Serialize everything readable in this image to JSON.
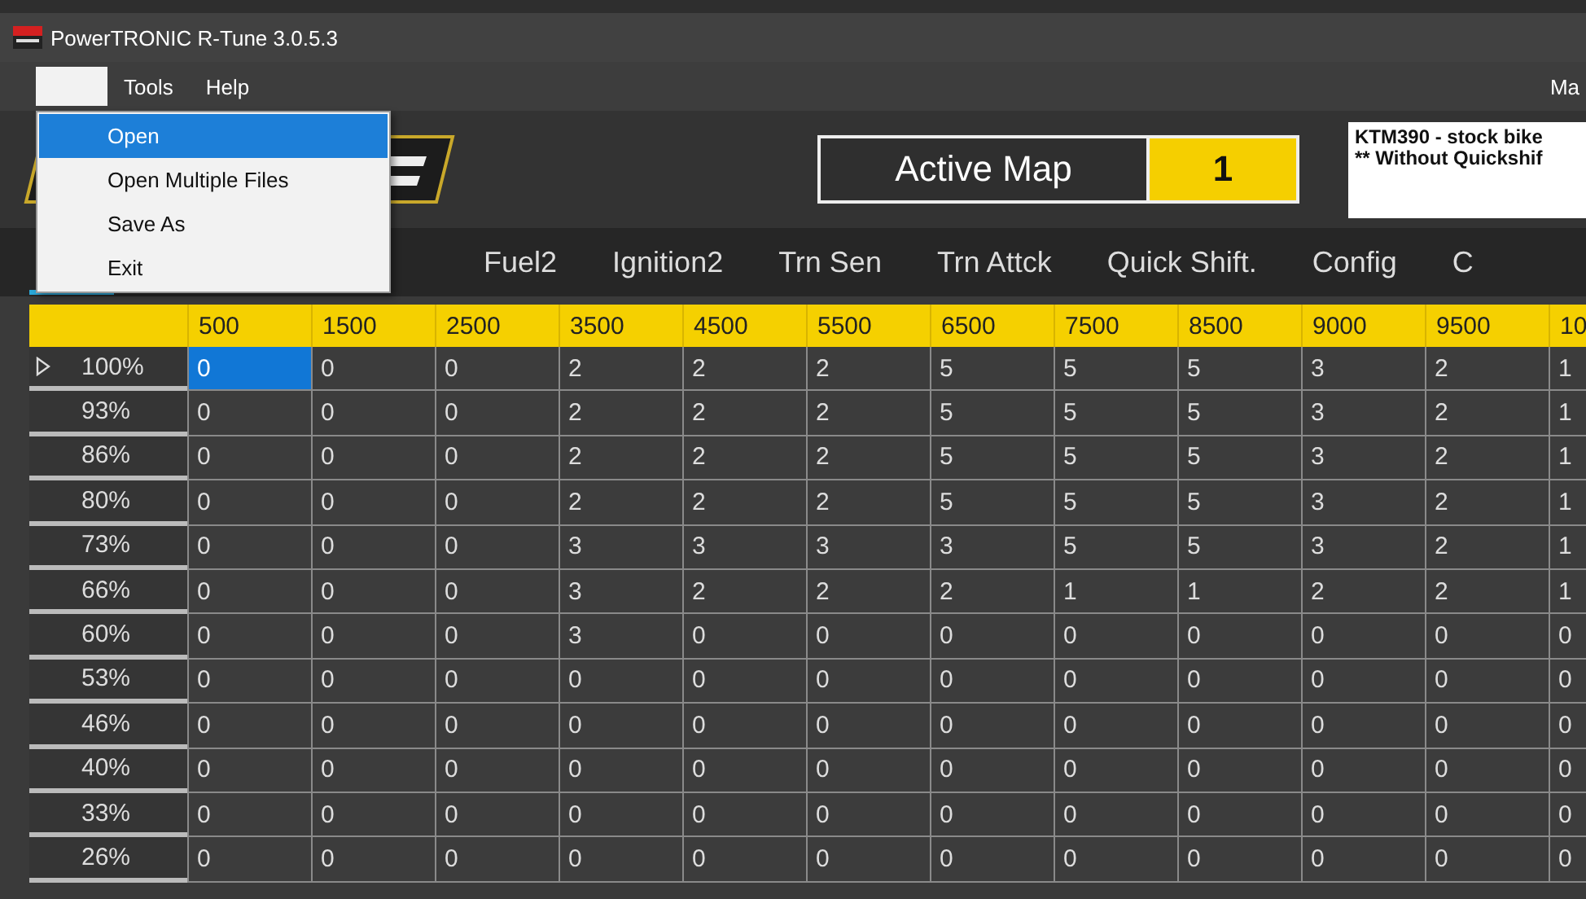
{
  "window": {
    "title": "PowerTRONIC R-Tune 3.0.5.3"
  },
  "menu_bar": {
    "items": [
      {
        "label": "Tools"
      },
      {
        "label": "Help"
      }
    ],
    "right_text": "Ma"
  },
  "file_menu": {
    "items": [
      {
        "label": "Open",
        "selected": true
      },
      {
        "label": "Open Multiple Files",
        "selected": false
      },
      {
        "label": "Save As",
        "selected": false
      },
      {
        "label": "Exit",
        "selected": false
      }
    ]
  },
  "active_map": {
    "label": "Active Map",
    "value": "1"
  },
  "notes": [
    "KTM390 - stock bike",
    "** Without Quickshif"
  ],
  "tabs": [
    "Fuel2",
    "Ignition2",
    "Trn Sen",
    "Trn Attck",
    "Quick Shift.",
    "Config",
    "C"
  ],
  "table": {
    "columns": [
      "500",
      "1500",
      "2500",
      "3500",
      "4500",
      "5500",
      "6500",
      "7500",
      "8500",
      "9000",
      "9500",
      "10"
    ],
    "rows": [
      {
        "label": "100%",
        "selected": true,
        "cells": [
          {
            "v": "0",
            "selected": true
          },
          {
            "v": "0",
            "selected": false
          },
          {
            "v": "0",
            "selected": false
          },
          {
            "v": "2",
            "selected": false
          },
          {
            "v": "2",
            "selected": false
          },
          {
            "v": "2",
            "selected": false
          },
          {
            "v": "5",
            "selected": false
          },
          {
            "v": "5",
            "selected": false
          },
          {
            "v": "5",
            "selected": false
          },
          {
            "v": "3",
            "selected": false
          },
          {
            "v": "2",
            "selected": false
          },
          {
            "v": "1",
            "selected": false
          }
        ]
      },
      {
        "label": "93%",
        "selected": false,
        "cells": [
          {
            "v": "0",
            "selected": false
          },
          {
            "v": "0",
            "selected": false
          },
          {
            "v": "0",
            "selected": false
          },
          {
            "v": "2",
            "selected": false
          },
          {
            "v": "2",
            "selected": false
          },
          {
            "v": "2",
            "selected": false
          },
          {
            "v": "5",
            "selected": false
          },
          {
            "v": "5",
            "selected": false
          },
          {
            "v": "5",
            "selected": false
          },
          {
            "v": "3",
            "selected": false
          },
          {
            "v": "2",
            "selected": false
          },
          {
            "v": "1",
            "selected": false
          }
        ]
      },
      {
        "label": "86%",
        "selected": false,
        "cells": [
          {
            "v": "0",
            "selected": false
          },
          {
            "v": "0",
            "selected": false
          },
          {
            "v": "0",
            "selected": false
          },
          {
            "v": "2",
            "selected": false
          },
          {
            "v": "2",
            "selected": false
          },
          {
            "v": "2",
            "selected": false
          },
          {
            "v": "5",
            "selected": false
          },
          {
            "v": "5",
            "selected": false
          },
          {
            "v": "5",
            "selected": false
          },
          {
            "v": "3",
            "selected": false
          },
          {
            "v": "2",
            "selected": false
          },
          {
            "v": "1",
            "selected": false
          }
        ]
      },
      {
        "label": "80%",
        "selected": false,
        "cells": [
          {
            "v": "0",
            "selected": false
          },
          {
            "v": "0",
            "selected": false
          },
          {
            "v": "0",
            "selected": false
          },
          {
            "v": "2",
            "selected": false
          },
          {
            "v": "2",
            "selected": false
          },
          {
            "v": "2",
            "selected": false
          },
          {
            "v": "5",
            "selected": false
          },
          {
            "v": "5",
            "selected": false
          },
          {
            "v": "5",
            "selected": false
          },
          {
            "v": "3",
            "selected": false
          },
          {
            "v": "2",
            "selected": false
          },
          {
            "v": "1",
            "selected": false
          }
        ]
      },
      {
        "label": "73%",
        "selected": false,
        "cells": [
          {
            "v": "0",
            "selected": false
          },
          {
            "v": "0",
            "selected": false
          },
          {
            "v": "0",
            "selected": false
          },
          {
            "v": "3",
            "selected": false
          },
          {
            "v": "3",
            "selected": false
          },
          {
            "v": "3",
            "selected": false
          },
          {
            "v": "3",
            "selected": false
          },
          {
            "v": "5",
            "selected": false
          },
          {
            "v": "5",
            "selected": false
          },
          {
            "v": "3",
            "selected": false
          },
          {
            "v": "2",
            "selected": false
          },
          {
            "v": "1",
            "selected": false
          }
        ]
      },
      {
        "label": "66%",
        "selected": false,
        "cells": [
          {
            "v": "0",
            "selected": false
          },
          {
            "v": "0",
            "selected": false
          },
          {
            "v": "0",
            "selected": false
          },
          {
            "v": "3",
            "selected": false
          },
          {
            "v": "2",
            "selected": false
          },
          {
            "v": "2",
            "selected": false
          },
          {
            "v": "2",
            "selected": false
          },
          {
            "v": "1",
            "selected": false
          },
          {
            "v": "1",
            "selected": false
          },
          {
            "v": "2",
            "selected": false
          },
          {
            "v": "2",
            "selected": false
          },
          {
            "v": "1",
            "selected": false
          }
        ]
      },
      {
        "label": "60%",
        "selected": false,
        "cells": [
          {
            "v": "0",
            "selected": false
          },
          {
            "v": "0",
            "selected": false
          },
          {
            "v": "0",
            "selected": false
          },
          {
            "v": "3",
            "selected": false
          },
          {
            "v": "0",
            "selected": false
          },
          {
            "v": "0",
            "selected": false
          },
          {
            "v": "0",
            "selected": false
          },
          {
            "v": "0",
            "selected": false
          },
          {
            "v": "0",
            "selected": false
          },
          {
            "v": "0",
            "selected": false
          },
          {
            "v": "0",
            "selected": false
          },
          {
            "v": "0",
            "selected": false
          }
        ]
      },
      {
        "label": "53%",
        "selected": false,
        "cells": [
          {
            "v": "0",
            "selected": false
          },
          {
            "v": "0",
            "selected": false
          },
          {
            "v": "0",
            "selected": false
          },
          {
            "v": "0",
            "selected": false
          },
          {
            "v": "0",
            "selected": false
          },
          {
            "v": "0",
            "selected": false
          },
          {
            "v": "0",
            "selected": false
          },
          {
            "v": "0",
            "selected": false
          },
          {
            "v": "0",
            "selected": false
          },
          {
            "v": "0",
            "selected": false
          },
          {
            "v": "0",
            "selected": false
          },
          {
            "v": "0",
            "selected": false
          }
        ]
      },
      {
        "label": "46%",
        "selected": false,
        "cells": [
          {
            "v": "0",
            "selected": false
          },
          {
            "v": "0",
            "selected": false
          },
          {
            "v": "0",
            "selected": false
          },
          {
            "v": "0",
            "selected": false
          },
          {
            "v": "0",
            "selected": false
          },
          {
            "v": "0",
            "selected": false
          },
          {
            "v": "0",
            "selected": false
          },
          {
            "v": "0",
            "selected": false
          },
          {
            "v": "0",
            "selected": false
          },
          {
            "v": "0",
            "selected": false
          },
          {
            "v": "0",
            "selected": false
          },
          {
            "v": "0",
            "selected": false
          }
        ]
      },
      {
        "label": "40%",
        "selected": false,
        "cells": [
          {
            "v": "0",
            "selected": false
          },
          {
            "v": "0",
            "selected": false
          },
          {
            "v": "0",
            "selected": false
          },
          {
            "v": "0",
            "selected": false
          },
          {
            "v": "0",
            "selected": false
          },
          {
            "v": "0",
            "selected": false
          },
          {
            "v": "0",
            "selected": false
          },
          {
            "v": "0",
            "selected": false
          },
          {
            "v": "0",
            "selected": false
          },
          {
            "v": "0",
            "selected": false
          },
          {
            "v": "0",
            "selected": false
          },
          {
            "v": "0",
            "selected": false
          }
        ]
      },
      {
        "label": "33%",
        "selected": false,
        "cells": [
          {
            "v": "0",
            "selected": false
          },
          {
            "v": "0",
            "selected": false
          },
          {
            "v": "0",
            "selected": false
          },
          {
            "v": "0",
            "selected": false
          },
          {
            "v": "0",
            "selected": false
          },
          {
            "v": "0",
            "selected": false
          },
          {
            "v": "0",
            "selected": false
          },
          {
            "v": "0",
            "selected": false
          },
          {
            "v": "0",
            "selected": false
          },
          {
            "v": "0",
            "selected": false
          },
          {
            "v": "0",
            "selected": false
          },
          {
            "v": "0",
            "selected": false
          }
        ]
      },
      {
        "label": "26%",
        "selected": false,
        "cells": [
          {
            "v": "0",
            "selected": false
          },
          {
            "v": "0",
            "selected": false
          },
          {
            "v": "0",
            "selected": false
          },
          {
            "v": "0",
            "selected": false
          },
          {
            "v": "0",
            "selected": false
          },
          {
            "v": "0",
            "selected": false
          },
          {
            "v": "0",
            "selected": false
          },
          {
            "v": "0",
            "selected": false
          },
          {
            "v": "0",
            "selected": false
          },
          {
            "v": "0",
            "selected": false
          },
          {
            "v": "0",
            "selected": false
          },
          {
            "v": "0",
            "selected": false
          }
        ]
      }
    ]
  }
}
